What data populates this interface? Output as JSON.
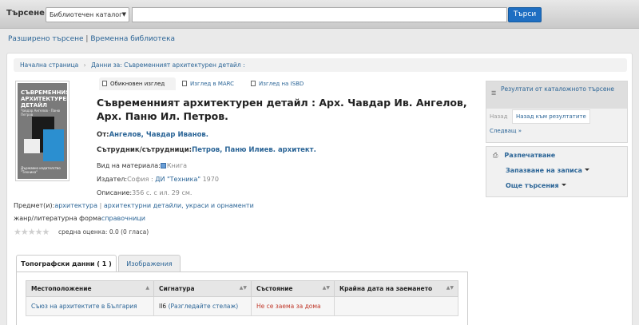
{
  "header": {
    "search_label": "Търсене",
    "search_scope": "Библиотечен каталог",
    "search_value": "",
    "search_button": "Търси"
  },
  "sublinks": {
    "advanced": "Разширено търсене",
    "separator": "|",
    "temp_library": "Временна библиотека"
  },
  "breadcrumb": {
    "home": "Начална страница",
    "current": "Данни за: Съвременният архитектурен детайл :"
  },
  "cover": {
    "title_text": "СЪВРЕМЕННИЯТ АРХИТЕКТУРЕН ДЕТАЙЛ",
    "authors_text": "Чавдар Ангелов · Паню Петров",
    "publisher_text": "Държавно издателство \"Техника\""
  },
  "view_tabs": {
    "normal": "Обикновен изглед",
    "marc": "Изглед в MARC",
    "isbd": "Изглед на ISBD"
  },
  "record": {
    "title": "Съвременният архитектурен детайл : Арх. Чавдар Ив. Ангелов, Арх. Паню Ил. Петров.",
    "by_label": "От:",
    "by_value": "Ангелов, Чавдар Иванов.",
    "contrib_label": "Сътрудник/сътрудници:",
    "contrib_value": "Петров, Паню Илиев. архитект.",
    "material_label": "Вид на материала:",
    "material_value": "Книга",
    "publisher_label": "Издател:",
    "publisher_place": "София :",
    "publisher_name": "ДИ \"Техника\"",
    "publisher_year": "1970",
    "description_label": "Описание:",
    "description_value": "356 с. с ил. 29 см.",
    "subject_label": "Предмет(и):",
    "subject_1": "архитектура",
    "subject_sep": "|",
    "subject_2": "архитектурни детайли, украси и орнаменти",
    "genre_label": "жанр/литературна форма",
    "genre_value": "справочници",
    "stars": "★★★★★",
    "rating_text": "средна оценка: 0.0 (0 гласа)"
  },
  "holdings_tabs": {
    "holdings": "Топографски данни ( 1 )",
    "images": "Изображения"
  },
  "holdings_table": {
    "headers": [
      "Местоположение",
      "Сигнатура",
      "Състояние",
      "Крайна дата на заемането"
    ],
    "rows": [
      {
        "location": "Съюз на архитектите в България",
        "callnumber": "II6",
        "browse_shelf": "(Разгледайте стелаж)",
        "status": "Не се заема за дома",
        "due": ""
      }
    ]
  },
  "sidebar": {
    "results_title": "Резултати от каталожното търсене",
    "prev": "Назад",
    "back_to_results": "Назад към резултатите",
    "next": "Следващ »",
    "print": "Разпечатване",
    "save": "Запазване на записа",
    "more_search": "Още търсения"
  },
  "colors": {
    "link": "#2a6496",
    "search_button": "#1e6ec2",
    "status_red": "#c0392b"
  }
}
